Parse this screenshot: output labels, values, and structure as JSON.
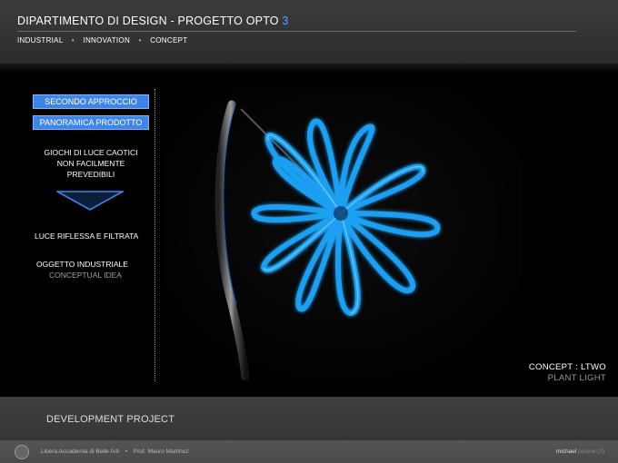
{
  "header": {
    "title_main": "DIPARTIMENTO DI DESIGN  -  PROGETTO OPTO",
    "title_number": "3",
    "nav": [
      "INDUSTRIAL",
      "INNOVATION",
      "CONCEPT"
    ]
  },
  "sidebar": {
    "button_1": "SECONDO APPROCCIO",
    "button_2": "PANORAMICA PRODOTTO",
    "giochi": [
      "GIOCHI DI LUCE CAOTICI",
      "NON FACILMENTE",
      "PREVEDIBILI"
    ],
    "luce": "LUCE RIFLESSA E FILTRATA",
    "oggetto": "OGGETTO INDUSTRIALE",
    "conceptual": "CONCEPTUAL IDEA"
  },
  "concept": {
    "title": "CONCEPT :   LTWO",
    "subtitle": "PLANT LIGHT"
  },
  "development": {
    "label": "DEVELOPMENT PROJECT"
  },
  "footer": {
    "academy": "Libera Accademia di Belle Arti",
    "professor": "Prof. Mauro Martinuz",
    "author_first": "michael",
    "author_second": "pisone (2)"
  },
  "colors": {
    "accent": "#3d86e8",
    "glow": "#1ea8ff",
    "background": "#000000",
    "band": "#3b3b3b"
  }
}
